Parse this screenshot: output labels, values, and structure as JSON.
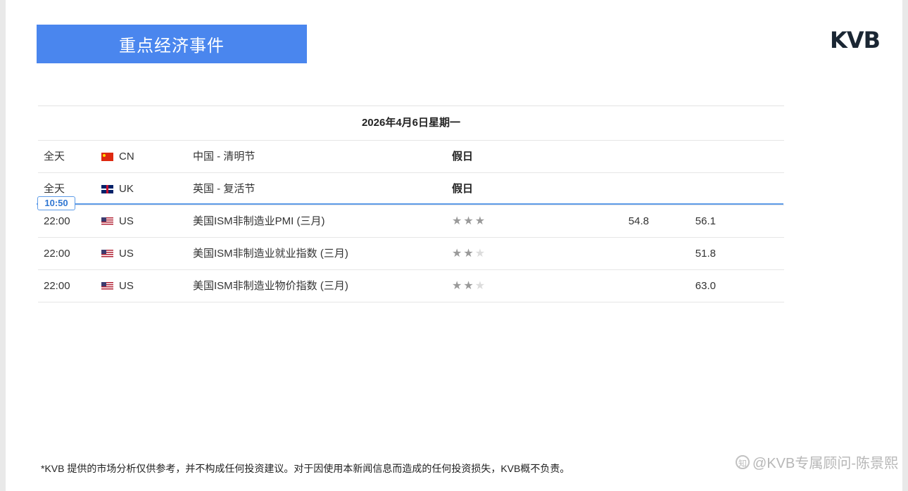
{
  "header": {
    "title": "重点经济事件",
    "logo_text": "KVB"
  },
  "calendar": {
    "date": "2026年4月6日星期一",
    "now_marker": "10:50",
    "rows": [
      {
        "time": "全天",
        "flag": "cn-flag-icon",
        "country": "CN",
        "event": "中国 - 清明节",
        "tag": "假日",
        "stars": 0,
        "previous": "",
        "forecast": ""
      },
      {
        "time": "全天",
        "flag": "uk-flag-icon",
        "country": "UK",
        "event": "英国 - 复活节",
        "tag": "假日",
        "stars": 0,
        "previous": "",
        "forecast": ""
      },
      {
        "time": "22:00",
        "flag": "us-flag-icon",
        "country": "US",
        "event": "美国ISM非制造业PMI (三月)",
        "tag": "",
        "stars": 3,
        "previous": "54.8",
        "forecast": "56.1"
      },
      {
        "time": "22:00",
        "flag": "us-flag-icon",
        "country": "US",
        "event": "美国ISM非制造业就业指数 (三月)",
        "tag": "",
        "stars": 2,
        "previous": "",
        "forecast": "51.8"
      },
      {
        "time": "22:00",
        "flag": "us-flag-icon",
        "country": "US",
        "event": "美国ISM非制造业物价指数 (三月)",
        "tag": "",
        "stars": 2,
        "previous": "",
        "forecast": "63.0"
      }
    ]
  },
  "footer": {
    "disclaimer": "*KVB 提供的市场分析仅供参考，并不构成任何投资建议。对于因使用本新闻信息而造成的任何投资损失，KVB概不负责。",
    "watermark": "@KVB专属顾问-陈景熙"
  },
  "colors": {
    "banner": "#4a86ee",
    "now_line": "#5d9be8",
    "star_on": "#9a9a9a",
    "star_off": "#dcdcdc"
  }
}
